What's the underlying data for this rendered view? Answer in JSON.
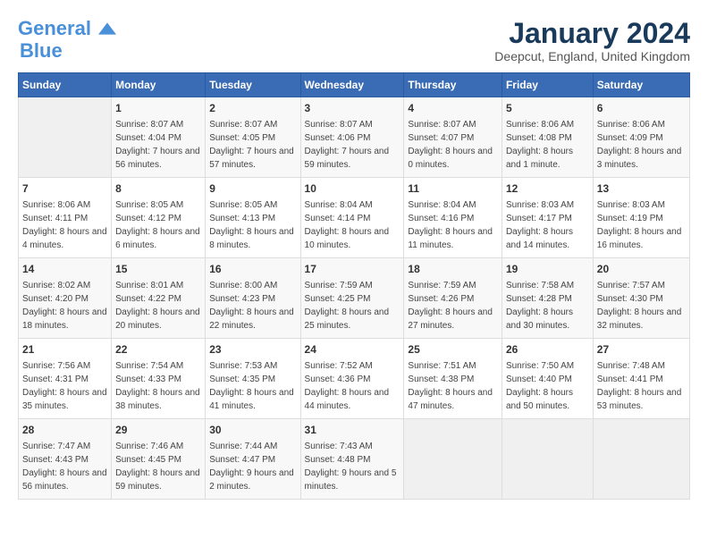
{
  "header": {
    "logo_line1": "General",
    "logo_line2": "Blue",
    "month": "January 2024",
    "location": "Deepcut, England, United Kingdom"
  },
  "weekdays": [
    "Sunday",
    "Monday",
    "Tuesday",
    "Wednesday",
    "Thursday",
    "Friday",
    "Saturday"
  ],
  "weeks": [
    [
      {
        "day": "",
        "sunrise": "",
        "sunset": "",
        "daylight": ""
      },
      {
        "day": "1",
        "sunrise": "Sunrise: 8:07 AM",
        "sunset": "Sunset: 4:04 PM",
        "daylight": "Daylight: 7 hours and 56 minutes."
      },
      {
        "day": "2",
        "sunrise": "Sunrise: 8:07 AM",
        "sunset": "Sunset: 4:05 PM",
        "daylight": "Daylight: 7 hours and 57 minutes."
      },
      {
        "day": "3",
        "sunrise": "Sunrise: 8:07 AM",
        "sunset": "Sunset: 4:06 PM",
        "daylight": "Daylight: 7 hours and 59 minutes."
      },
      {
        "day": "4",
        "sunrise": "Sunrise: 8:07 AM",
        "sunset": "Sunset: 4:07 PM",
        "daylight": "Daylight: 8 hours and 0 minutes."
      },
      {
        "day": "5",
        "sunrise": "Sunrise: 8:06 AM",
        "sunset": "Sunset: 4:08 PM",
        "daylight": "Daylight: 8 hours and 1 minute."
      },
      {
        "day": "6",
        "sunrise": "Sunrise: 8:06 AM",
        "sunset": "Sunset: 4:09 PM",
        "daylight": "Daylight: 8 hours and 3 minutes."
      }
    ],
    [
      {
        "day": "7",
        "sunrise": "Sunrise: 8:06 AM",
        "sunset": "Sunset: 4:11 PM",
        "daylight": "Daylight: 8 hours and 4 minutes."
      },
      {
        "day": "8",
        "sunrise": "Sunrise: 8:05 AM",
        "sunset": "Sunset: 4:12 PM",
        "daylight": "Daylight: 8 hours and 6 minutes."
      },
      {
        "day": "9",
        "sunrise": "Sunrise: 8:05 AM",
        "sunset": "Sunset: 4:13 PM",
        "daylight": "Daylight: 8 hours and 8 minutes."
      },
      {
        "day": "10",
        "sunrise": "Sunrise: 8:04 AM",
        "sunset": "Sunset: 4:14 PM",
        "daylight": "Daylight: 8 hours and 10 minutes."
      },
      {
        "day": "11",
        "sunrise": "Sunrise: 8:04 AM",
        "sunset": "Sunset: 4:16 PM",
        "daylight": "Daylight: 8 hours and 11 minutes."
      },
      {
        "day": "12",
        "sunrise": "Sunrise: 8:03 AM",
        "sunset": "Sunset: 4:17 PM",
        "daylight": "Daylight: 8 hours and 14 minutes."
      },
      {
        "day": "13",
        "sunrise": "Sunrise: 8:03 AM",
        "sunset": "Sunset: 4:19 PM",
        "daylight": "Daylight: 8 hours and 16 minutes."
      }
    ],
    [
      {
        "day": "14",
        "sunrise": "Sunrise: 8:02 AM",
        "sunset": "Sunset: 4:20 PM",
        "daylight": "Daylight: 8 hours and 18 minutes."
      },
      {
        "day": "15",
        "sunrise": "Sunrise: 8:01 AM",
        "sunset": "Sunset: 4:22 PM",
        "daylight": "Daylight: 8 hours and 20 minutes."
      },
      {
        "day": "16",
        "sunrise": "Sunrise: 8:00 AM",
        "sunset": "Sunset: 4:23 PM",
        "daylight": "Daylight: 8 hours and 22 minutes."
      },
      {
        "day": "17",
        "sunrise": "Sunrise: 7:59 AM",
        "sunset": "Sunset: 4:25 PM",
        "daylight": "Daylight: 8 hours and 25 minutes."
      },
      {
        "day": "18",
        "sunrise": "Sunrise: 7:59 AM",
        "sunset": "Sunset: 4:26 PM",
        "daylight": "Daylight: 8 hours and 27 minutes."
      },
      {
        "day": "19",
        "sunrise": "Sunrise: 7:58 AM",
        "sunset": "Sunset: 4:28 PM",
        "daylight": "Daylight: 8 hours and 30 minutes."
      },
      {
        "day": "20",
        "sunrise": "Sunrise: 7:57 AM",
        "sunset": "Sunset: 4:30 PM",
        "daylight": "Daylight: 8 hours and 32 minutes."
      }
    ],
    [
      {
        "day": "21",
        "sunrise": "Sunrise: 7:56 AM",
        "sunset": "Sunset: 4:31 PM",
        "daylight": "Daylight: 8 hours and 35 minutes."
      },
      {
        "day": "22",
        "sunrise": "Sunrise: 7:54 AM",
        "sunset": "Sunset: 4:33 PM",
        "daylight": "Daylight: 8 hours and 38 minutes."
      },
      {
        "day": "23",
        "sunrise": "Sunrise: 7:53 AM",
        "sunset": "Sunset: 4:35 PM",
        "daylight": "Daylight: 8 hours and 41 minutes."
      },
      {
        "day": "24",
        "sunrise": "Sunrise: 7:52 AM",
        "sunset": "Sunset: 4:36 PM",
        "daylight": "Daylight: 8 hours and 44 minutes."
      },
      {
        "day": "25",
        "sunrise": "Sunrise: 7:51 AM",
        "sunset": "Sunset: 4:38 PM",
        "daylight": "Daylight: 8 hours and 47 minutes."
      },
      {
        "day": "26",
        "sunrise": "Sunrise: 7:50 AM",
        "sunset": "Sunset: 4:40 PM",
        "daylight": "Daylight: 8 hours and 50 minutes."
      },
      {
        "day": "27",
        "sunrise": "Sunrise: 7:48 AM",
        "sunset": "Sunset: 4:41 PM",
        "daylight": "Daylight: 8 hours and 53 minutes."
      }
    ],
    [
      {
        "day": "28",
        "sunrise": "Sunrise: 7:47 AM",
        "sunset": "Sunset: 4:43 PM",
        "daylight": "Daylight: 8 hours and 56 minutes."
      },
      {
        "day": "29",
        "sunrise": "Sunrise: 7:46 AM",
        "sunset": "Sunset: 4:45 PM",
        "daylight": "Daylight: 8 hours and 59 minutes."
      },
      {
        "day": "30",
        "sunrise": "Sunrise: 7:44 AM",
        "sunset": "Sunset: 4:47 PM",
        "daylight": "Daylight: 9 hours and 2 minutes."
      },
      {
        "day": "31",
        "sunrise": "Sunrise: 7:43 AM",
        "sunset": "Sunset: 4:48 PM",
        "daylight": "Daylight: 9 hours and 5 minutes."
      },
      {
        "day": "",
        "sunrise": "",
        "sunset": "",
        "daylight": ""
      },
      {
        "day": "",
        "sunrise": "",
        "sunset": "",
        "daylight": ""
      },
      {
        "day": "",
        "sunrise": "",
        "sunset": "",
        "daylight": ""
      }
    ]
  ]
}
